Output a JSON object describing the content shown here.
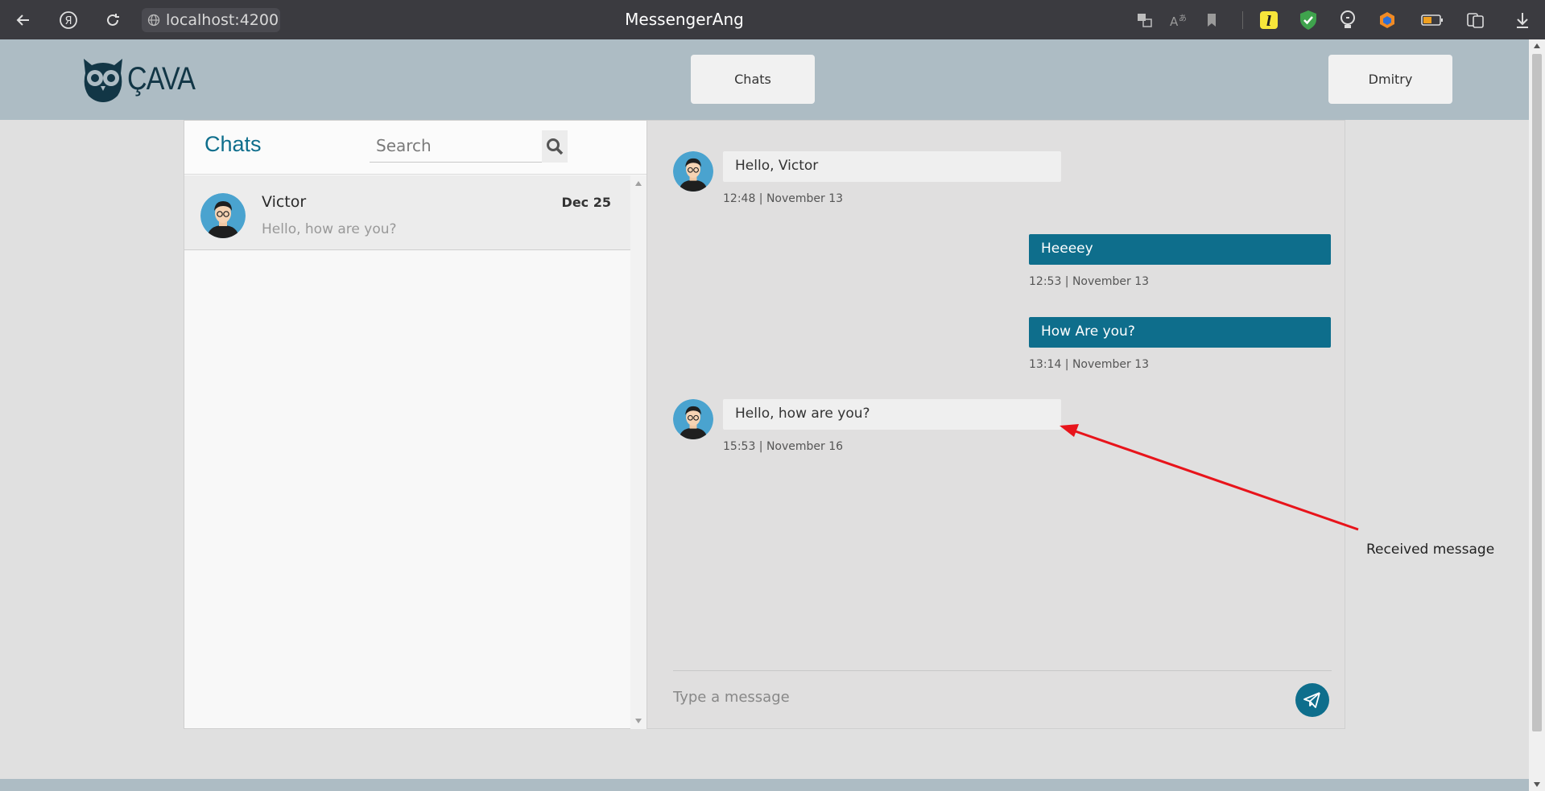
{
  "browser": {
    "url": "localhost:4200",
    "tab_title": "MessengerAng",
    "extensions": [
      "translate-icon",
      "reader-icon",
      "bookmark-icon",
      "extension-l-icon",
      "shield-check-icon",
      "lightbulb-icon",
      "hex-extension-icon",
      "battery-icon",
      "pages-icon",
      "download-icon"
    ]
  },
  "header": {
    "logo_text": "ÇAVA",
    "nav": {
      "chats_label": "Chats",
      "user_label": "Dmitry"
    }
  },
  "chat_list": {
    "title": "Chats",
    "search_placeholder": "Search",
    "items": [
      {
        "name": "Victor",
        "date": "Dec 25",
        "preview": "Hello, how are you?"
      }
    ]
  },
  "conversation": {
    "messages": [
      {
        "direction": "in",
        "text": "Hello, Victor",
        "meta": "12:48 | November 13"
      },
      {
        "direction": "out",
        "text": "Heeeey",
        "meta": "12:53 | November 13"
      },
      {
        "direction": "out",
        "text": "How Are you?",
        "meta": "13:14 | November 13"
      },
      {
        "direction": "in",
        "text": "Hello, how are you?",
        "meta": "15:53 | November 16"
      }
    ],
    "composer_placeholder": "Type a message"
  },
  "annotation": {
    "label": "Received message",
    "arrow_color": "#e8141b"
  },
  "colors": {
    "accent": "#0e6e8c",
    "header_bg": "#adbcc4",
    "browser_bg": "#3b3b40"
  }
}
